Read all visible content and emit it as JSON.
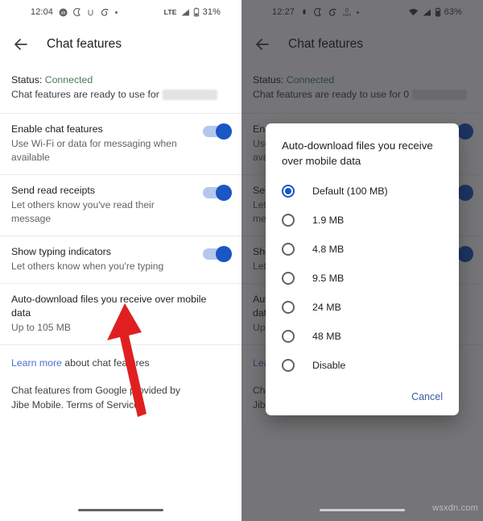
{
  "left": {
    "statusbar": {
      "time": "12:04",
      "icons": [
        "record-icon",
        "do-not-disturb-icon",
        "u-icon",
        "vibrate-icon",
        "more-dot-icon"
      ],
      "network": "LTE",
      "battery_percent": "31%"
    },
    "appbar": {
      "title": "Chat features",
      "back_icon": "back-arrow-icon"
    },
    "status": {
      "label": "Status:",
      "value": "Connected",
      "ready_text": "Chat features are ready to use for",
      "redacted": true
    },
    "settings": [
      {
        "title": "Enable chat features",
        "subtitle": "Use Wi-Fi or data for messaging when available",
        "toggle": "on"
      },
      {
        "title": "Send read receipts",
        "subtitle": "Let others know you've read their message",
        "toggle": "on"
      },
      {
        "title": "Show typing indicators",
        "subtitle": "Let others know when you're typing",
        "toggle": "on"
      }
    ],
    "autodownload": {
      "title": "Auto-download files you receive over mobile data",
      "subtitle": "Up to 105 MB"
    },
    "learn_more": {
      "link": "Learn more",
      "rest": " about chat features"
    },
    "footer": "Chat features from Google provided by Jibe Mobile. Terms of Service."
  },
  "right": {
    "statusbar": {
      "time": "12:27",
      "icons": [
        "record-icon",
        "do-not-disturb-icon",
        "vibrate-icon",
        "data-speed-icon",
        "more-dot-icon"
      ],
      "data_rate": "0",
      "data_rate_unit": "KB/s",
      "battery_percent": "63%"
    },
    "appbar": {
      "title": "Chat features",
      "back_icon": "back-arrow-icon"
    },
    "status": {
      "label": "Status:",
      "value": "Connected",
      "ready_text": "Chat features are ready to use for 0"
    },
    "dialog": {
      "title": "Auto-download files you receive over mobile data",
      "options": [
        {
          "label": "Default (100 MB)",
          "selected": true
        },
        {
          "label": "1.9 MB",
          "selected": false
        },
        {
          "label": "4.8 MB",
          "selected": false
        },
        {
          "label": "9.5 MB",
          "selected": false
        },
        {
          "label": "24 MB",
          "selected": false
        },
        {
          "label": "48 MB",
          "selected": false
        },
        {
          "label": "Disable",
          "selected": false
        }
      ],
      "cancel_label": "Cancel"
    }
  },
  "annotation": {
    "arrow_color": "#e02020"
  },
  "watermark": "wsxdn.com",
  "colors": {
    "accent_blue": "#1a56c4",
    "link_blue": "#4a6fd4",
    "status_green": "#3f7e56",
    "scrim": "rgba(32,33,36,.62)"
  }
}
